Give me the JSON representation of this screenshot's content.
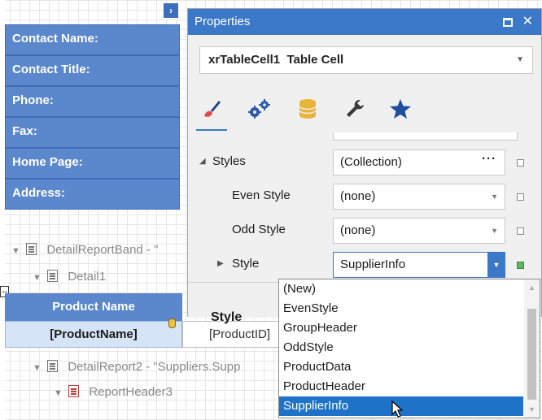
{
  "designer": {
    "contact_labels": [
      "Contact Name:",
      "Contact Title:",
      "Phone:",
      "Fax:",
      "Home Page:",
      "Address:"
    ],
    "tree": {
      "detail_report_band": "DetailReportBand - \"",
      "detail1": "Detail1",
      "detail_report2": "DetailReport2 - \"Suppliers.Supp",
      "report_header3": "ReportHeader3"
    },
    "band": {
      "header": "Product Name",
      "cell": "[ProductName]",
      "cell2": "[ProductID]"
    },
    "expand_glyph": "›"
  },
  "properties": {
    "title": "Properties",
    "selector": {
      "name": "xrTableCell1",
      "type": "Table Cell"
    },
    "tabs": [
      "brush-icon",
      "gears-icon",
      "database-icon",
      "wrench-icon",
      "star-icon"
    ],
    "rows": [
      {
        "name": "Styles",
        "value": "(Collection)",
        "expandable": true,
        "expanded": true,
        "editor": "ellipsis"
      },
      {
        "name": "Even Style",
        "value": "(none)",
        "editor": "dropdown"
      },
      {
        "name": "Odd Style",
        "value": "(none)",
        "editor": "dropdown"
      },
      {
        "name": "Style",
        "value": "SupplierInfo",
        "expandable": true,
        "expanded": false,
        "editor": "dropdown-focused",
        "modified": true
      }
    ],
    "description_title": "Style"
  },
  "dropdown": {
    "items": [
      "(New)",
      "EvenStyle",
      "GroupHeader",
      "OddStyle",
      "ProductData",
      "ProductHeader",
      "SupplierInfo"
    ],
    "selected_index": 6
  },
  "colors": {
    "accent": "#3b78c7",
    "band_fill": "#5b87cc",
    "selected_item": "#1e73c8",
    "modified_marker": "#5cb85c"
  }
}
